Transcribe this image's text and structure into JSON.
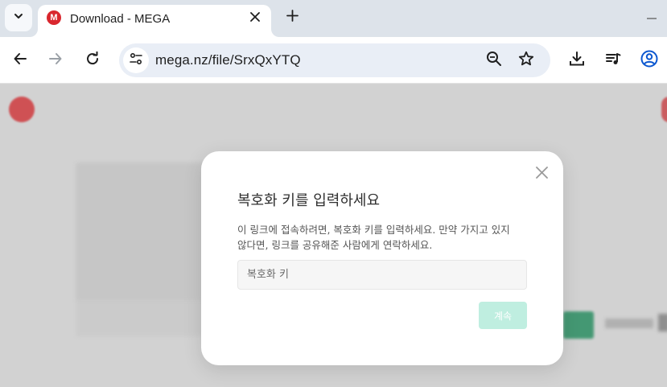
{
  "browser": {
    "tab": {
      "title": "Download - MEGA",
      "favicon_letter": "M",
      "favicon_color": "#d9272e"
    },
    "address_bar": {
      "url": "mega.nz/file/SrxQxYTQ"
    },
    "icons": [
      "tab-search-icon",
      "close-icon",
      "plus-icon",
      "minimize-icon",
      "back-icon",
      "forward-icon",
      "reload-icon",
      "site-info-icon",
      "zoom-icon",
      "star-icon",
      "download-icon",
      "media-queue-icon",
      "profile-icon"
    ]
  },
  "dialog": {
    "title": "복호화 키를 입력하세요",
    "description_line1": "이 링크에 접속하려면, 복호화 키를 입력하세요. 만약 가지고 있지",
    "description_line2": "않다면, 링크를 공유해준 사람에게 연락하세요.",
    "input_placeholder": "복호화 키",
    "input_value": "",
    "submit_label": "계속",
    "submit_color": "#bfeee0"
  },
  "colors": {
    "mega_red": "#d9272e",
    "accent_green": "#2c8f63"
  }
}
